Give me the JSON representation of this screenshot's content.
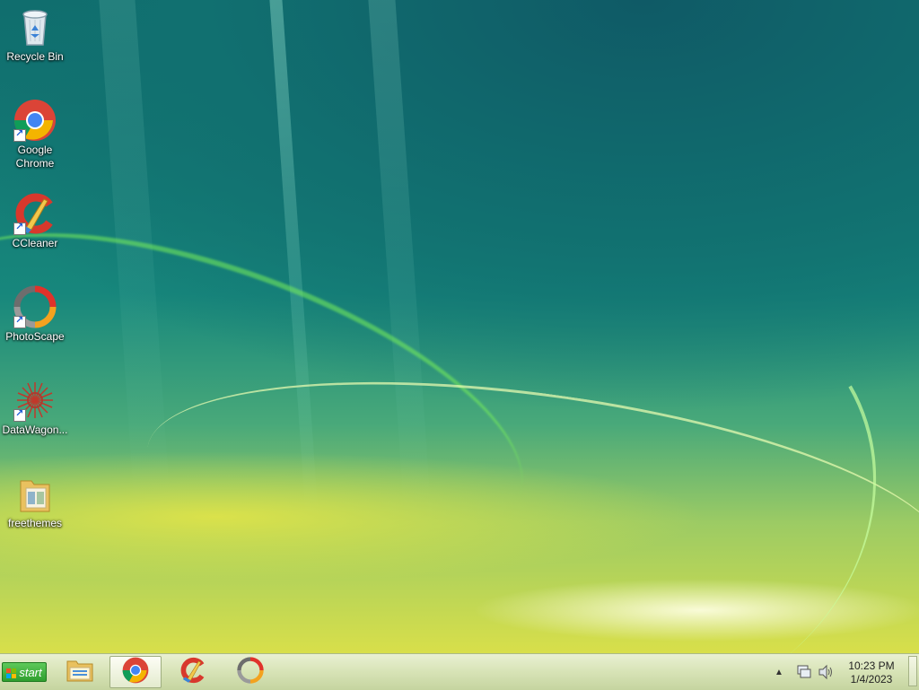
{
  "desktop": {
    "icons": [
      {
        "label": "Recycle Bin",
        "icon": "recycle-bin-icon"
      },
      {
        "label": "Google Chrome",
        "icon": "chrome-icon"
      },
      {
        "label": "CCleaner",
        "icon": "ccleaner-icon"
      },
      {
        "label": "PhotoScape",
        "icon": "photoscape-icon"
      },
      {
        "label": "DataWagon...",
        "icon": "datawagon-icon"
      },
      {
        "label": "freethemes",
        "icon": "folder-icon"
      }
    ]
  },
  "taskbar": {
    "start_label": "start",
    "pinned": [
      {
        "name": "file-explorer",
        "icon": "file-explorer-icon"
      },
      {
        "name": "chrome",
        "icon": "chrome-icon",
        "active": true
      },
      {
        "name": "ccleaner",
        "icon": "ccleaner-icon"
      },
      {
        "name": "photoscape",
        "icon": "photoscape-icon"
      }
    ],
    "tray": {
      "icons": [
        "chevron-up-icon",
        "network-icon",
        "volume-icon"
      ],
      "time": "10:23 PM",
      "date": "1/4/2023"
    }
  },
  "colors": {
    "start_green": "#2f9e2e",
    "taskbar": "#d7e3b6",
    "desktop_teal": "#117070"
  }
}
